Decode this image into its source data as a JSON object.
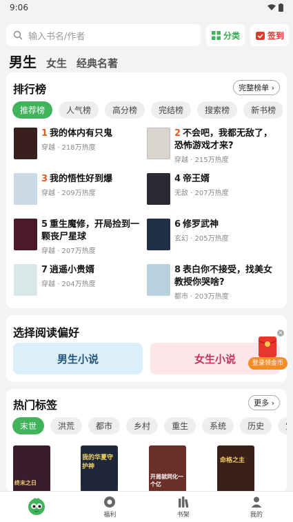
{
  "status": {
    "time": "9:06"
  },
  "search": {
    "placeholder": "输入书名/作者"
  },
  "actions": {
    "category": "分类",
    "signin": "签到"
  },
  "gender_tabs": [
    "男生",
    "女生",
    "经典名著"
  ],
  "ranking": {
    "title": "排行榜",
    "full_list": "完整榜单",
    "chips": [
      "推荐榜",
      "人气榜",
      "高分榜",
      "完结榜",
      "搜索榜",
      "新书榜"
    ],
    "items": [
      {
        "rank": "1",
        "title": "我的体内有只鬼",
        "meta": "穿越 · 218万热度",
        "color": "#3a1f1f"
      },
      {
        "rank": "2",
        "title": "不会吧，我都无敌了，恐怖游戏才来?",
        "meta": "穿越 · 215万热度",
        "color": "#d9d4cc"
      },
      {
        "rank": "3",
        "title": "我的悟性好到爆",
        "meta": "穿越 · 209万热度",
        "color": "#c9d9e6"
      },
      {
        "rank": "4",
        "title": "帝王婿",
        "meta": "无敌 · 207万热度",
        "color": "#2a2a36"
      },
      {
        "rank": "5",
        "title": "重生魔修，开局捡到一颗丧尸星球",
        "meta": "穿越 · 207万热度",
        "color": "#4a1a2a"
      },
      {
        "rank": "6",
        "title": "修罗武神",
        "meta": "玄幻 · 205万热度",
        "color": "#1e2f46"
      },
      {
        "rank": "7",
        "title": "逍遥小贵婿",
        "meta": "穿越 · 204万热度",
        "color": "#d8e8e8"
      },
      {
        "rank": "8",
        "title": "表白你不接受，找美女教授你哭啥?",
        "meta": "都市 · 203万热度",
        "color": "#b9d1dc"
      }
    ]
  },
  "preference": {
    "title": "选择阅读偏好",
    "male": "男生小说",
    "female": "女生小说"
  },
  "float_badge": {
    "label": "登录领金币"
  },
  "hot_tags": {
    "title": "热门标签",
    "more": "更多",
    "chips": [
      "末世",
      "洪荒",
      "都市",
      "乡村",
      "重生",
      "系统",
      "历史",
      "宝"
    ],
    "covers": [
      {
        "color": "#3b1c2a",
        "text": "终末之日"
      },
      {
        "color": "#1f2738",
        "text": "我的华夏守护神"
      },
      {
        "color": "#6b2f2a",
        "text": "开局就同化一个亿"
      },
      {
        "color": "#3a2016",
        "text": "命格之主"
      }
    ]
  },
  "tabbar": [
    "",
    "福利",
    "书架",
    "我的"
  ]
}
